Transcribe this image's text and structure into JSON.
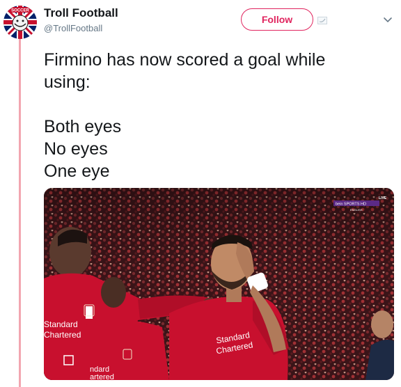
{
  "author": {
    "name": "Troll Football",
    "handle": "@TrollFootball",
    "avatar_text": "SOCCER"
  },
  "follow_button": {
    "label": "Follow"
  },
  "tweet": {
    "lines": [
      "Firmino has now scored a goal while",
      "using:",
      "",
      "Both eyes",
      "No eyes",
      "One eye"
    ]
  },
  "media": {
    "broadcast_live": "LIVE",
    "broadcast_channel": "bein SPORTS HD",
    "broadcast_sub": "ENGLISH",
    "sponsor_left_top": "Standard",
    "sponsor_left_bottom": "Chartered",
    "sponsor_right_top": "Standard",
    "sponsor_right_bottom": "Chartered",
    "sponsor_bottom_top": "ndard",
    "sponsor_bottom_bottom": "artered"
  },
  "colors": {
    "follow": "#e0245e",
    "thread": "#f2a6b0",
    "kit_red": "#c8102e"
  }
}
